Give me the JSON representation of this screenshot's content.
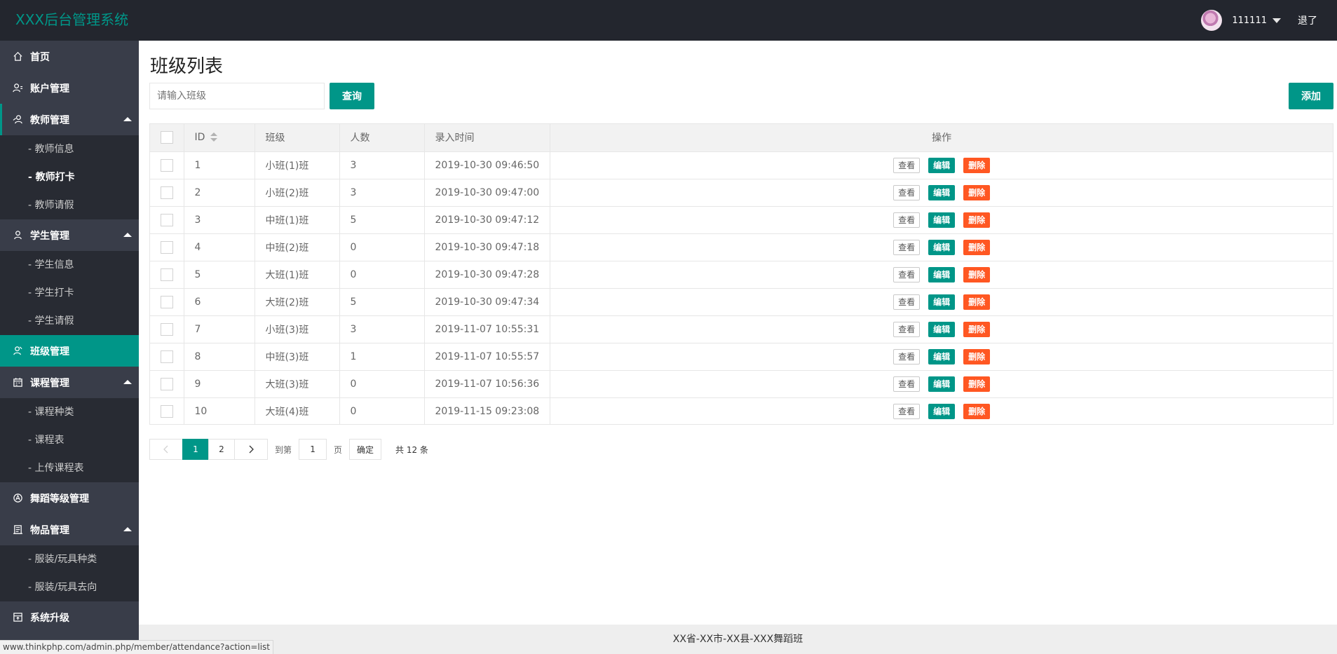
{
  "app": {
    "title": "XXX后台管理系统"
  },
  "header": {
    "username": "111111",
    "logout_label": "退了"
  },
  "sidebar": {
    "groups": [
      {
        "label": "首页",
        "icon": "home-icon"
      },
      {
        "label": "账户管理",
        "icon": "users-icon"
      },
      {
        "label": "教师管理",
        "icon": "teacher-icon",
        "expanded": true,
        "items": [
          "- 教师信息",
          "- 教师打卡",
          "- 教师请假"
        ]
      },
      {
        "label": "学生管理",
        "icon": "student-icon",
        "expanded": true,
        "items": [
          "- 学生信息",
          "- 学生打卡",
          "- 学生请假"
        ]
      },
      {
        "label": "班级管理",
        "icon": "class-icon",
        "active": true
      },
      {
        "label": "课程管理",
        "icon": "calendar-icon",
        "expanded": true,
        "items": [
          "- 课程种类",
          "- 课程表",
          "- 上传课程表"
        ]
      },
      {
        "label": "舞蹈等级管理",
        "icon": "level-icon"
      },
      {
        "label": "物品管理",
        "icon": "goods-icon",
        "expanded": true,
        "items": [
          "- 服装/玩具种类",
          "- 服装/玩具去向"
        ]
      },
      {
        "label": "系统升级",
        "icon": "upgrade-icon"
      }
    ]
  },
  "main": {
    "page_title": "班级列表",
    "search": {
      "placeholder": "请输入班级",
      "value": ""
    },
    "query_label": "查询",
    "add_label": "添加"
  },
  "table": {
    "columns": [
      "ID",
      "班级",
      "人数",
      "录入时间",
      "操作"
    ],
    "actions": {
      "view": "查看",
      "edit": "编辑",
      "delete": "删除"
    },
    "rows": [
      [
        "1",
        "小班(1)班",
        "3",
        "2019-10-30 09:46:50"
      ],
      [
        "2",
        "小班(2)班",
        "3",
        "2019-10-30 09:47:00"
      ],
      [
        "3",
        "中班(1)班",
        "5",
        "2019-10-30 09:47:12"
      ],
      [
        "4",
        "中班(2)班",
        "0",
        "2019-10-30 09:47:18"
      ],
      [
        "5",
        "大班(1)班",
        "0",
        "2019-10-30 09:47:28"
      ],
      [
        "6",
        "大班(2)班",
        "5",
        "2019-10-30 09:47:34"
      ],
      [
        "7",
        "小班(3)班",
        "3",
        "2019-11-07 10:55:31"
      ],
      [
        "8",
        "中班(3)班",
        "1",
        "2019-11-07 10:55:57"
      ],
      [
        "9",
        "大班(3)班",
        "0",
        "2019-11-07 10:56:36"
      ],
      [
        "10",
        "大班(4)班",
        "0",
        "2019-11-15 09:23:08"
      ]
    ]
  },
  "pagination": {
    "pages": [
      "1",
      "2"
    ],
    "current_page": "1",
    "goto_label": "到第",
    "goto_value": "1",
    "page_suffix": "页",
    "confirm_label": "确定",
    "total_label": "共 12 条"
  },
  "footer": {
    "text": "XX省-XX市-XX县-XXX舞蹈班"
  },
  "status_bar": {
    "url": "www.thinkphp.com/admin.php/member/attendance?action=list"
  },
  "colors": {
    "accent": "#009688",
    "danger": "#ff5722",
    "header_bg": "#23262e",
    "sidebar_bg": "#393d49"
  }
}
